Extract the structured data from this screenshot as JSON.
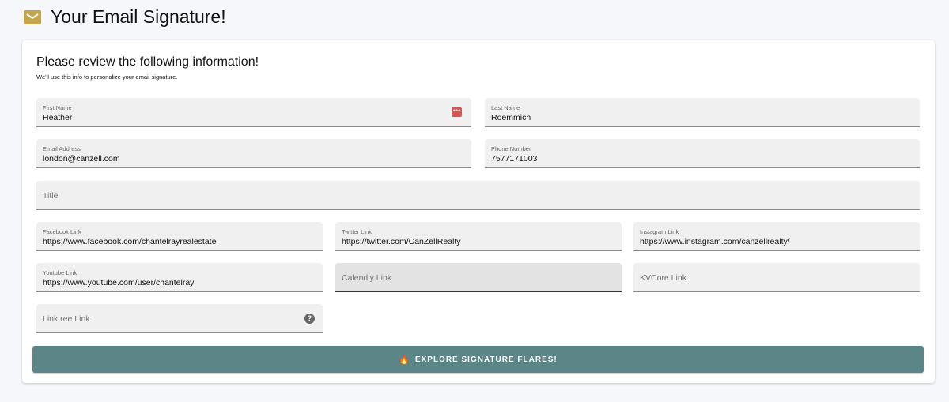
{
  "header": {
    "title": "Your Email Signature!",
    "icon": "envelope-icon",
    "icon_color": "#c4a54a"
  },
  "card": {
    "heading": "Please review the following information!",
    "subheading": "We'll use this info to personalize your email signature."
  },
  "fields": {
    "first_name": {
      "label": "First Name",
      "value": "Heather"
    },
    "last_name": {
      "label": "Last Name",
      "value": "Roemmich"
    },
    "email": {
      "label": "Email Address",
      "value": "london@canzell.com"
    },
    "phone": {
      "label": "Phone Number",
      "value": "7577171003"
    },
    "title": {
      "placeholder": "Title"
    },
    "facebook": {
      "label": "Facebook Link",
      "value": "https://www.facebook.com/chantelrayrealestate"
    },
    "twitter": {
      "label": "Twitter Link",
      "value": "https://twitter.com/CanZellRealty"
    },
    "instagram": {
      "label": "Instagram Link",
      "value": "https://www.instagram.com/canzellrealty/"
    },
    "youtube": {
      "label": "Youtube Link",
      "value": "https://www.youtube.com/user/chantelray"
    },
    "calendly": {
      "placeholder": "Calendly Link"
    },
    "kvcore": {
      "placeholder": "KVCore Link"
    },
    "linktree": {
      "placeholder": "Linktree Link",
      "help": "?"
    }
  },
  "button": {
    "label": "EXPLORE SIGNATURE FLARES!",
    "icon": "flame-icon",
    "color": "#5b8587"
  }
}
